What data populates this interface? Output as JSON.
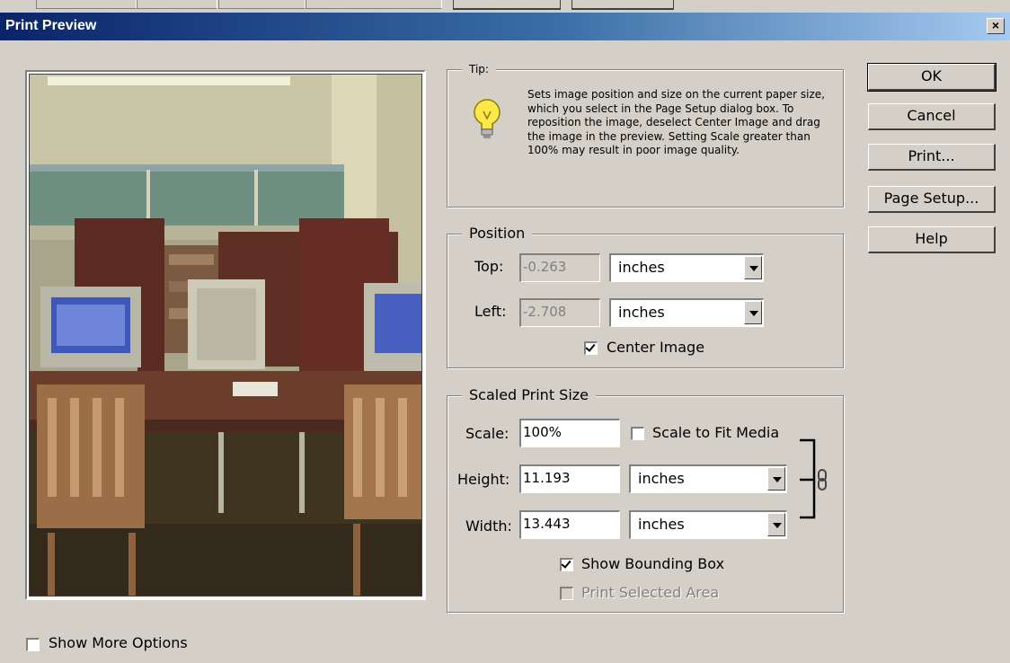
{
  "window": {
    "title": "Print Preview",
    "close_label": "×"
  },
  "tip": {
    "label": "Tip:",
    "text": "Sets image position and size on the current paper size, which you select in the Page Setup dialog box. To reposition the image, deselect Center Image and drag the image in the preview. Setting Scale greater than 100% may result in poor image quality."
  },
  "position": {
    "label": "Position",
    "top_label": "Top:",
    "top_value": "-0.263",
    "top_unit": "inches",
    "left_label": "Left:",
    "left_value": "-2.708",
    "left_unit": "inches",
    "center_image_label": "Center Image",
    "center_image_checked": true
  },
  "scaled": {
    "label": "Scaled Print Size",
    "scale_label": "Scale:",
    "scale_value": "100%",
    "scale_to_fit_label": "Scale to Fit Media",
    "height_label": "Height:",
    "height_value": "11.193",
    "height_unit": "inches",
    "width_label": "Width:",
    "width_value": "13.443",
    "width_unit": "inches",
    "show_bounding_box_label": "Show Bounding Box",
    "print_selected_area_label": "Print Selected Area"
  },
  "buttons": {
    "ok": "OK",
    "cancel": "Cancel",
    "print": "Print...",
    "page_setup": "Page Setup...",
    "help": "Help"
  },
  "footer": {
    "show_more_options_label": "Show More Options"
  },
  "colors": {
    "title_start": "#0a246a",
    "title_end": "#a6caf0",
    "face": "#d4d0c8"
  }
}
